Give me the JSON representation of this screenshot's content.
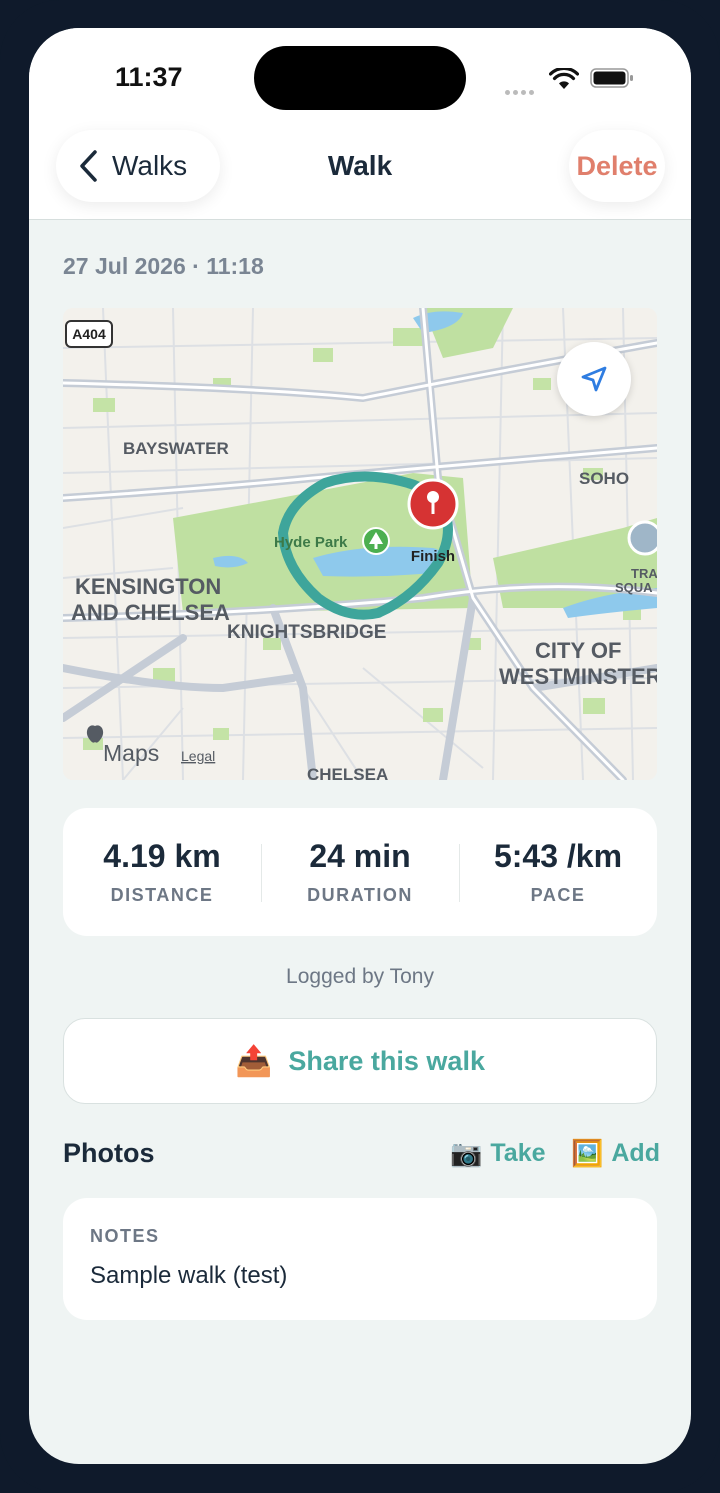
{
  "status_bar": {
    "time": "11:37"
  },
  "nav": {
    "back_label": "Walks",
    "title": "Walk",
    "delete_label": "Delete"
  },
  "walk": {
    "datetime": "27 Jul 2026 · 11:18"
  },
  "map": {
    "labels": {
      "road": "A404",
      "bayswater": "BAYSWATER",
      "soho": "SOHO",
      "hyde_park": "Hyde Park",
      "finish": "Finish",
      "kensington_1": "KENSINGTON",
      "kensington_2": "AND CHELSEA",
      "knightsbridge": "KNIGHTSBRIDGE",
      "westminster_1": "CITY OF",
      "westminster_2": "WESTMINSTER",
      "trafalgar_1": "TRAFAL",
      "trafalgar_2": "SQUA",
      "chelsea": "CHELSEA",
      "maps": "Maps",
      "legal": "Legal"
    },
    "route_color": "#3ea59b",
    "pin_color": "#d63333",
    "icons": {
      "locate": "location-arrow-icon",
      "park": "tree-icon",
      "pin": "map-pin-icon"
    }
  },
  "stats": [
    {
      "value": "4.19 km",
      "label": "DISTANCE"
    },
    {
      "value": "24 min",
      "label": "DURATION"
    },
    {
      "value": "5:43 /km",
      "label": "PACE"
    }
  ],
  "logged_by": "Logged by Tony",
  "share": {
    "icon": "📤",
    "label": "Share this walk"
  },
  "photos": {
    "title": "Photos",
    "take": {
      "icon": "📷",
      "label": "Take"
    },
    "add": {
      "icon": "🖼️",
      "label": "Add"
    }
  },
  "notes": {
    "label": "NOTES",
    "text": "Sample walk (test)"
  },
  "colors": {
    "accent": "#4aa89f",
    "delete": "#e07f6c",
    "text": "#1b2a3a",
    "muted": "#6d7785"
  }
}
